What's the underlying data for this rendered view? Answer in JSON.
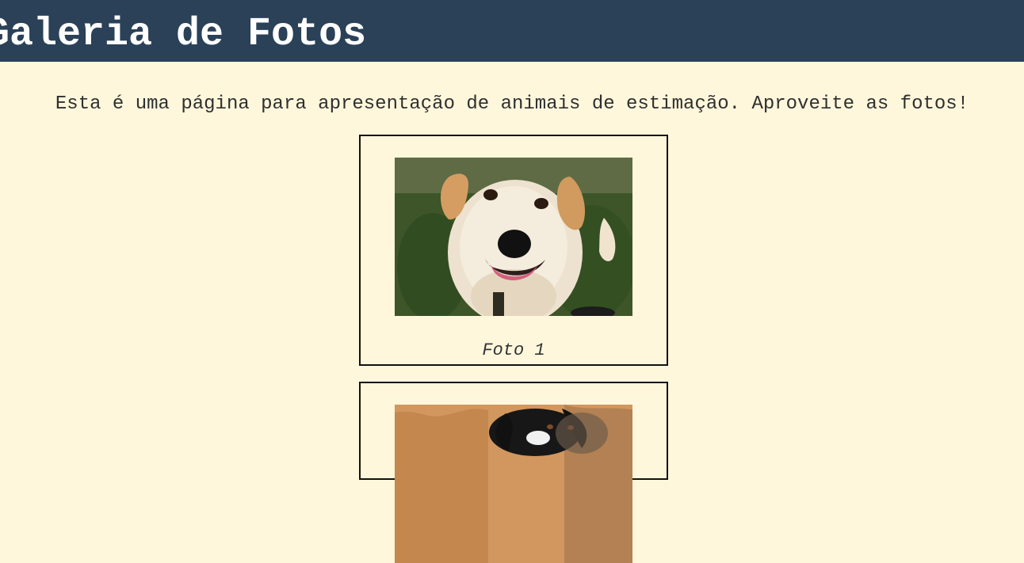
{
  "page": {
    "title": "Galeria de Fotos",
    "intro": "Esta é uma página para apresentação de animais de estimação. Aproveite as fotos!"
  },
  "gallery": {
    "items": [
      {
        "caption": "Foto 1",
        "photo_subject": "light-colored dog smiling on grass"
      },
      {
        "caption": "",
        "photo_subject": "black and white dog in front of rusty background"
      }
    ]
  },
  "colors": {
    "header_bg": "#2a4158",
    "page_bg": "#fff7dc",
    "header_text": "#ffffff",
    "body_text": "#2f2f2f",
    "frame_border": "#111111"
  }
}
